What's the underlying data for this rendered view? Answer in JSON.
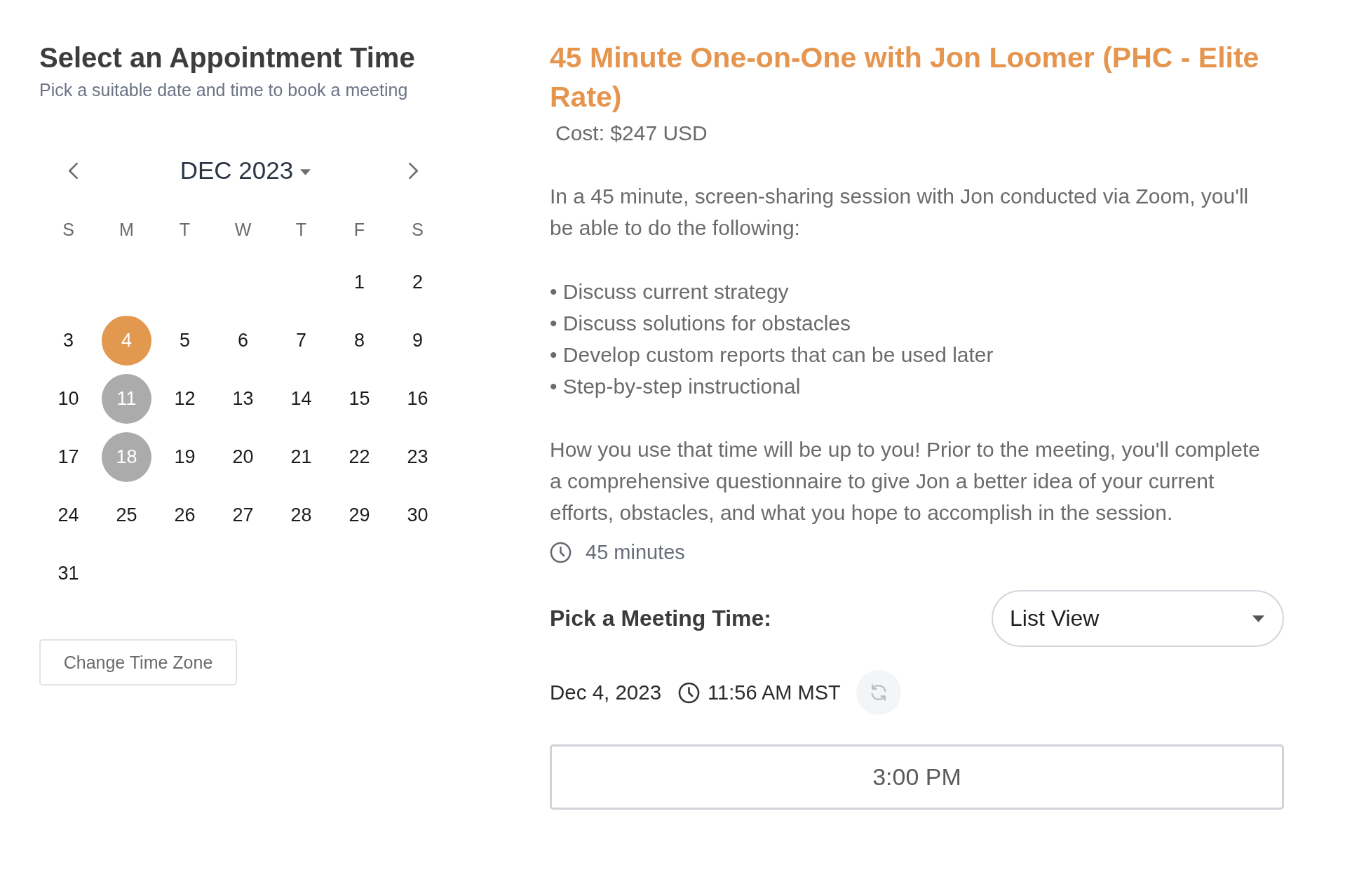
{
  "header": {
    "title": "Select an Appointment Time",
    "subtitle": "Pick a suitable date and time to book a meeting"
  },
  "calendar": {
    "month_label": "DEC 2023",
    "weekdays": [
      "S",
      "M",
      "T",
      "W",
      "T",
      "F",
      "S"
    ],
    "weeks": [
      [
        {
          "label": "1",
          "selected": false,
          "available": false
        },
        {
          "label": "2",
          "selected": false,
          "available": false
        }
      ],
      [
        {
          "label": "3",
          "selected": false,
          "available": false
        },
        {
          "label": "4",
          "selected": true,
          "available": true
        },
        {
          "label": "5",
          "selected": false,
          "available": false
        },
        {
          "label": "6",
          "selected": false,
          "available": false
        },
        {
          "label": "7",
          "selected": false,
          "available": false
        },
        {
          "label": "8",
          "selected": false,
          "available": false
        },
        {
          "label": "9",
          "selected": false,
          "available": false
        }
      ],
      [
        {
          "label": "10",
          "selected": false,
          "available": false
        },
        {
          "label": "11",
          "selected": false,
          "available": true
        },
        {
          "label": "12",
          "selected": false,
          "available": false
        },
        {
          "label": "13",
          "selected": false,
          "available": false
        },
        {
          "label": "14",
          "selected": false,
          "available": false
        },
        {
          "label": "15",
          "selected": false,
          "available": false
        },
        {
          "label": "16",
          "selected": false,
          "available": false
        }
      ],
      [
        {
          "label": "17",
          "selected": false,
          "available": false
        },
        {
          "label": "18",
          "selected": false,
          "available": true
        },
        {
          "label": "19",
          "selected": false,
          "available": false
        },
        {
          "label": "20",
          "selected": false,
          "available": false
        },
        {
          "label": "21",
          "selected": false,
          "available": false
        },
        {
          "label": "22",
          "selected": false,
          "available": false
        },
        {
          "label": "23",
          "selected": false,
          "available": false
        }
      ],
      [
        {
          "label": "24",
          "selected": false,
          "available": false
        },
        {
          "label": "25",
          "selected": false,
          "available": false
        },
        {
          "label": "26",
          "selected": false,
          "available": false
        },
        {
          "label": "27",
          "selected": false,
          "available": false
        },
        {
          "label": "28",
          "selected": false,
          "available": false
        },
        {
          "label": "29",
          "selected": false,
          "available": false
        },
        {
          "label": "30",
          "selected": false,
          "available": false
        }
      ],
      [
        {
          "label": "31",
          "selected": false,
          "available": false
        }
      ]
    ]
  },
  "change_timezone_button": "Change Time Zone",
  "service": {
    "title": "45 Minute One-on-One with Jon Loomer (PHC - Elite Rate)",
    "cost": "Cost: $247 USD",
    "intro": "In a 45 minute, screen-sharing session with Jon conducted via Zoom, you'll be able to do the following:",
    "bullets": [
      "• Discuss current strategy",
      "• Discuss solutions for obstacles",
      "• Develop custom reports that can be used later",
      "• Step-by-step instructional"
    ],
    "closing": "How you use that time will be up to you! Prior to the meeting, you'll complete a comprehensive questionnaire to give Jon a better idea of your current efforts, obstacles, and what you hope to accomplish in the session.",
    "duration": "45 minutes"
  },
  "meeting_time": {
    "label": "Pick a Meeting Time:",
    "view_select": {
      "value": "List View"
    },
    "date": "Dec 4, 2023",
    "current_time": "11:56 AM MST",
    "slots": [
      {
        "label": "3:00 PM",
        "selected": false
      }
    ]
  }
}
